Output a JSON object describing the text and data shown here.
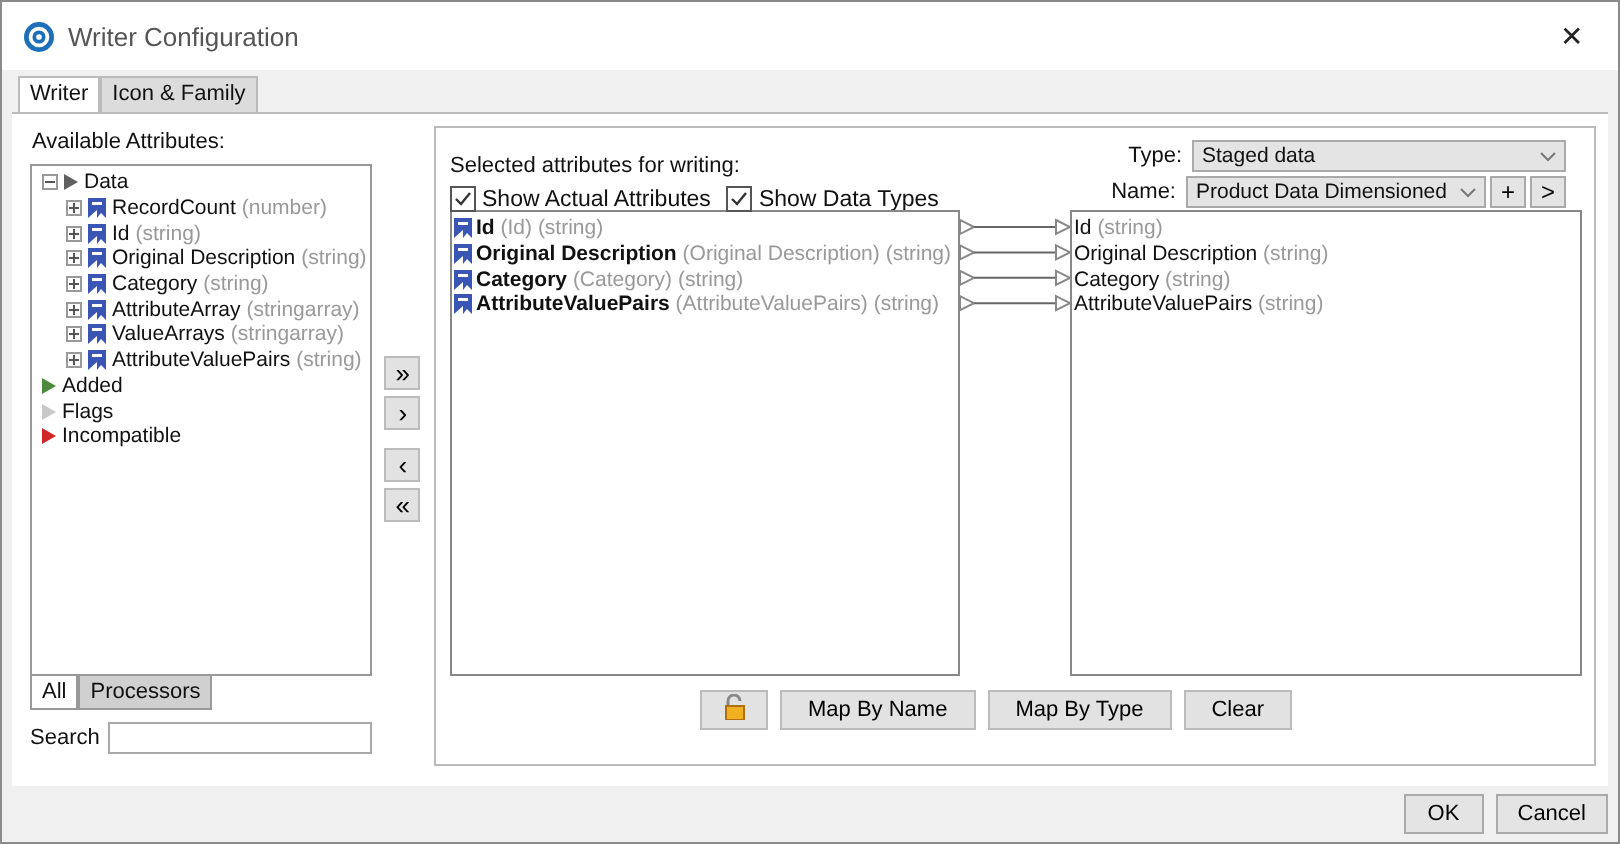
{
  "window": {
    "title": "Writer Configuration",
    "close": "✕"
  },
  "tabs": [
    {
      "label": "Writer",
      "selected": true
    },
    {
      "label": "Icon & Family",
      "selected": false
    }
  ],
  "available": {
    "label": "Available Attributes:",
    "tree": [
      {
        "label": "Data",
        "expanded": true,
        "color": "#606060",
        "children": [
          {
            "label": "RecordCount",
            "type": "(number)",
            "expanded": false
          },
          {
            "label": "Id",
            "type": "(string)",
            "expanded": false
          },
          {
            "label": "Original Description",
            "type": "(string)",
            "expanded": false
          },
          {
            "label": "Category",
            "type": "(string)",
            "expanded": false
          },
          {
            "label": "AttributeArray",
            "type": "(stringarray)",
            "expanded": false
          },
          {
            "label": "ValueArrays",
            "type": "(stringarray)",
            "expanded": false
          },
          {
            "label": "AttributeValuePairs",
            "type": "(string)",
            "expanded": false
          }
        ]
      },
      {
        "label": "Added",
        "color": "#4a8a3a"
      },
      {
        "label": "Flags",
        "color": "#c8c8c8"
      },
      {
        "label": "Incompatible",
        "color": "#d02828"
      }
    ],
    "filter_tabs": [
      {
        "label": "All",
        "selected": true
      },
      {
        "label": "Processors",
        "selected": false
      }
    ],
    "search": {
      "label": "Search"
    }
  },
  "move_buttons": [
    "»",
    "›",
    "‹",
    "«"
  ],
  "selected": {
    "label": "Selected attributes for writing:",
    "checkboxes": [
      {
        "label": "Show Actual Attributes",
        "checked": true
      },
      {
        "label": "Show Data Types",
        "checked": true
      }
    ],
    "type": {
      "label": "Type:",
      "value": "Staged data"
    },
    "name": {
      "label": "Name:",
      "value": "Product Data Dimensioned",
      "add": "+",
      "next": ">"
    },
    "source_rows": [
      {
        "name": "Id",
        "actual": "(Id)",
        "type": "(string)"
      },
      {
        "name": "Original Description",
        "actual": "(Original Description)",
        "type": "(string)"
      },
      {
        "name": "Category",
        "actual": "(Category)",
        "type": "(string)"
      },
      {
        "name": "AttributeValuePairs",
        "actual": "(AttributeValuePairs)",
        "type": "(string)"
      }
    ],
    "target_rows": [
      {
        "name": "Id",
        "type": "(string)"
      },
      {
        "name": "Original Description",
        "type": "(string)"
      },
      {
        "name": "Category",
        "type": "(string)"
      },
      {
        "name": "AttributeValuePairs",
        "type": "(string)"
      }
    ],
    "buttons": [
      "Map By Name",
      "Map By Type",
      "Clear"
    ]
  },
  "footer_buttons": [
    "OK",
    "Cancel"
  ]
}
